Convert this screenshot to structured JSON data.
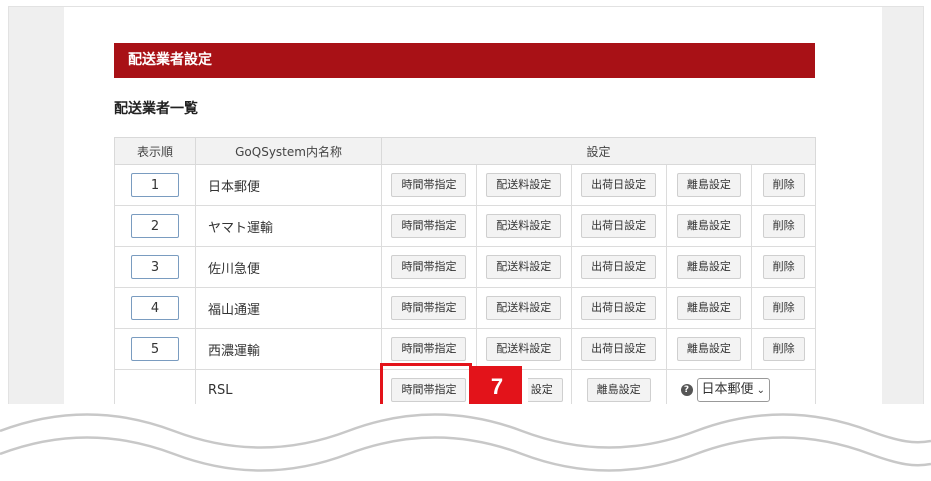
{
  "header": {
    "title": "配送業者設定"
  },
  "section": {
    "title": "配送業者一覧"
  },
  "table": {
    "headers": [
      "表示順",
      "GoQSystem内名称",
      "設定"
    ],
    "buttons": [
      "時間帯指定",
      "配送料設定",
      "出荷日設定",
      "離島設定",
      "削除"
    ],
    "rows": [
      {
        "order": "1",
        "name": "日本郵便"
      },
      {
        "order": "2",
        "name": "ヤマト運輸"
      },
      {
        "order": "3",
        "name": "佐川急便"
      },
      {
        "order": "4",
        "name": "福山通運"
      },
      {
        "order": "5",
        "name": "西濃運輸"
      }
    ],
    "rsl": {
      "name": "RSL",
      "time_button": "時間帯指定",
      "fee_button_partial": "設定",
      "island_button": "離島設定",
      "help": "?",
      "select_value": "日本郵便"
    }
  },
  "annotation": {
    "step": "7"
  },
  "colors": {
    "header_bg": "#a81116",
    "highlight": "#e3131a"
  }
}
